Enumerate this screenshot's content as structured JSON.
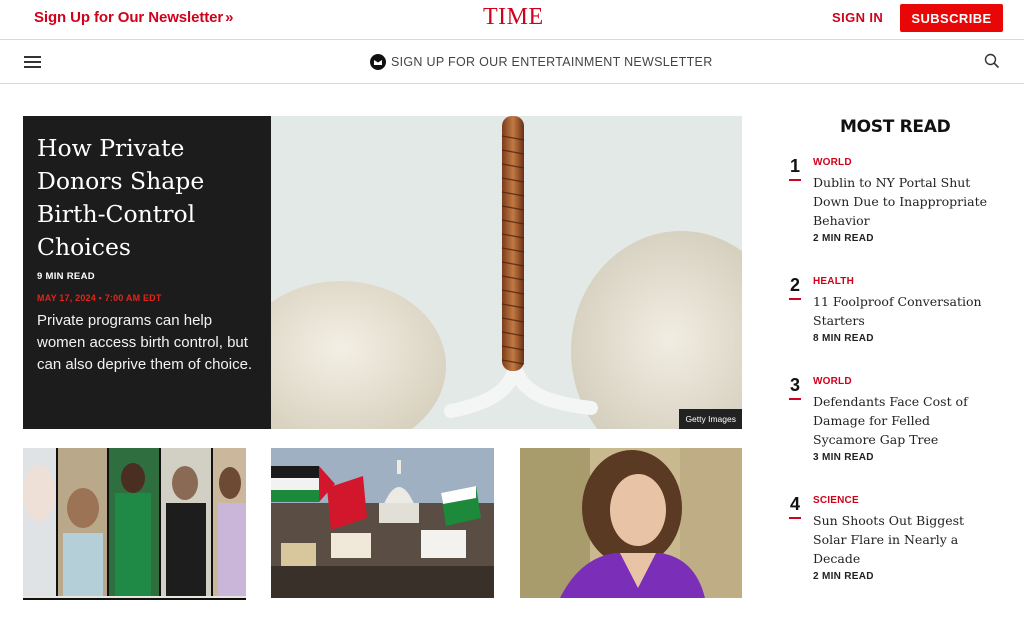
{
  "header": {
    "newsletter_link": "Sign Up for Our Newsletter",
    "newsletter_chevron": "»",
    "logo": "TIME",
    "sign_in": "SIGN IN",
    "subscribe": "SUBSCRIBE"
  },
  "subnav": {
    "entertainment_newsletter": "SIGN UP FOR OUR ENTERTAINMENT NEWSLETTER"
  },
  "hero": {
    "title": "How Private Donors Shape Birth-Control Choices",
    "read_time": "9 MIN READ",
    "date": "MAY 17, 2024 • 7:00 AM EDT",
    "description": "Private programs can help women access birth control, but can also deprive them of choice.",
    "credit": "Getty Images"
  },
  "most_read": {
    "title": "MOST READ",
    "items": [
      {
        "num": "1",
        "category": "WORLD",
        "headline": "Dublin to NY Portal Shut Down Due to Inappropriate Behavior",
        "read": "2 MIN READ"
      },
      {
        "num": "2",
        "category": "HEALTH",
        "headline": "11 Foolproof Conversation Starters",
        "read": "8 MIN READ"
      },
      {
        "num": "3",
        "category": "WORLD",
        "headline": "Defendants Face Cost of Damage for Felled Sycamore Gap Tree",
        "read": "3 MIN READ"
      },
      {
        "num": "4",
        "category": "SCIENCE",
        "headline": "Sun Shoots Out Biggest Solar Flare in Nearly a Decade",
        "read": "2 MIN READ"
      }
    ]
  },
  "colors": {
    "brand_red": "#d0021b",
    "subscribe_bg": "#e90606",
    "hero_panel": "#1c1c1c"
  }
}
